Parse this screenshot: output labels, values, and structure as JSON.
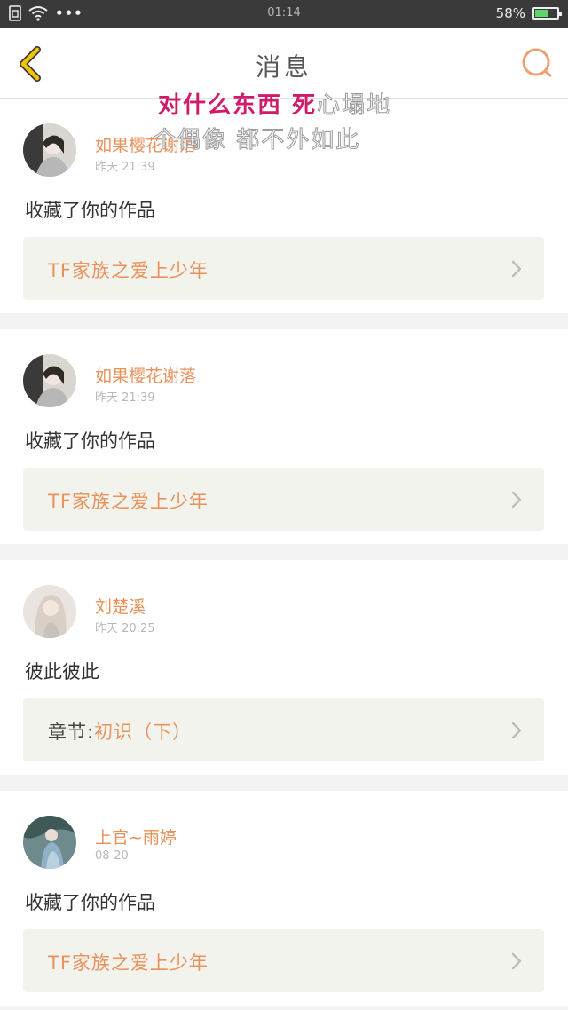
{
  "status_bar": {
    "time": "01:14",
    "battery": "58%",
    "battery_level": 0.58
  },
  "header": {
    "title": "消息"
  },
  "overlay": {
    "line1_bold": "对什么东西 死",
    "line1_soft": "心塌地",
    "line2": "个偶像 都不外如此"
  },
  "messages": [
    {
      "username": "如果樱花谢落",
      "time": "昨天 21:39",
      "text": "收藏了你的作品",
      "work_prefix": "",
      "work_title": "TF家族之爱上少年"
    },
    {
      "username": "如果樱花谢落",
      "time": "昨天 21:39",
      "text": "收藏了你的作品",
      "work_prefix": "",
      "work_title": "TF家族之爱上少年"
    },
    {
      "username": "刘楚溪",
      "time": "昨天 20:25",
      "text": "彼此彼此",
      "work_prefix": "章节:",
      "work_title": "初识（下）"
    },
    {
      "username": "上官~雨婷",
      "time": "08-20",
      "text": "收藏了你的作品",
      "work_prefix": "",
      "work_title": "TF家族之爱上少年"
    }
  ],
  "colors": {
    "accent": "#e8915b",
    "back_arrow": "#f2c300",
    "overlay_pink": "#d01b6a"
  }
}
